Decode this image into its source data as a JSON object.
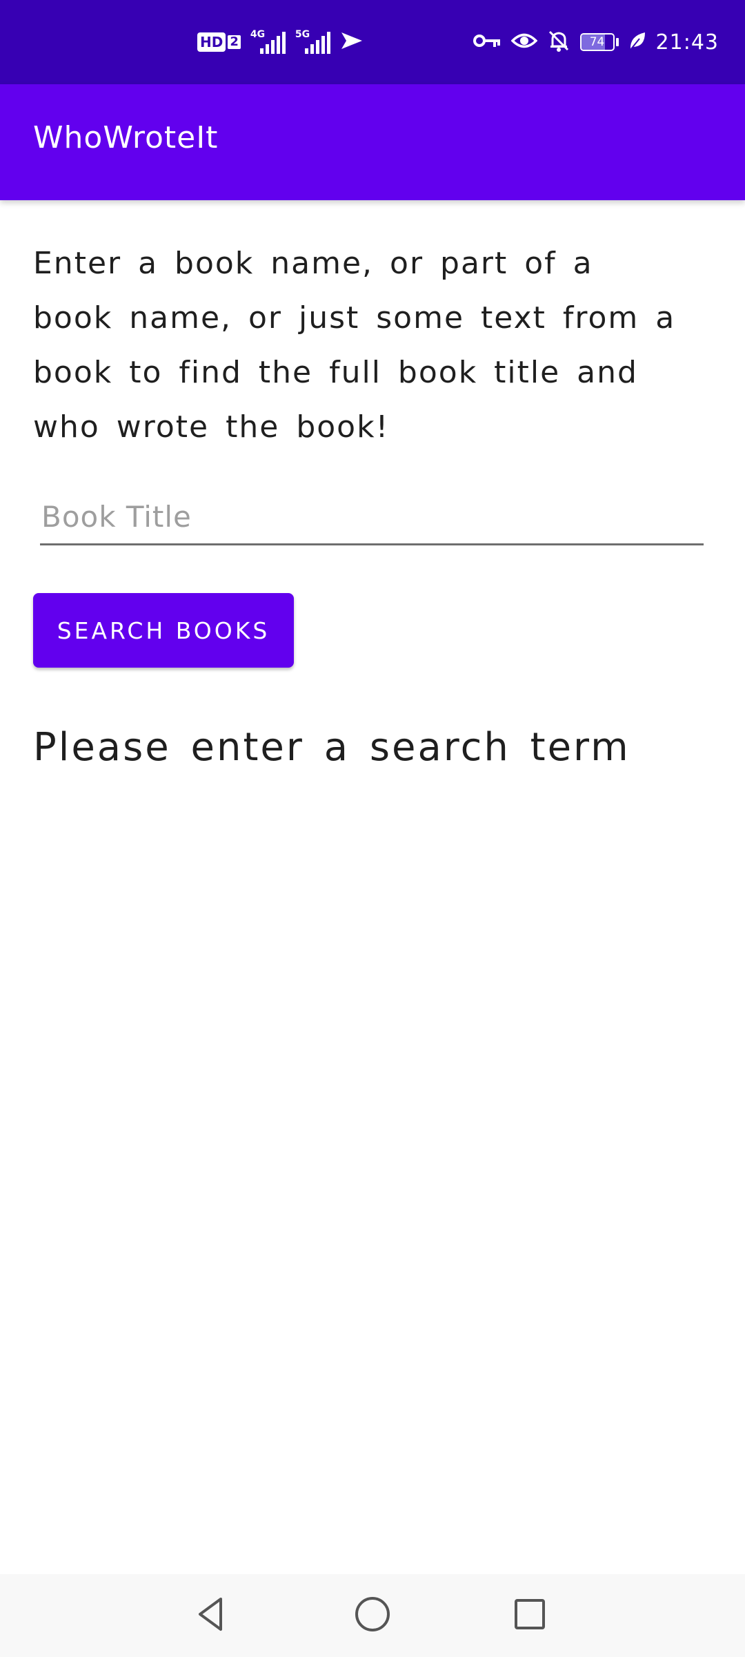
{
  "status_bar": {
    "hd_label": "HD",
    "sim_label": "2",
    "network_1": "4G",
    "network_2": "5G",
    "battery_level": 74,
    "battery_text": "74",
    "time": "21:43"
  },
  "app_bar": {
    "title": "WhoWroteIt"
  },
  "main": {
    "instructions": "Enter a book name, or part of a book name, or just some text from a book to find the full book title and who wrote the book!",
    "search_input": {
      "value": "",
      "placeholder": "Book Title"
    },
    "search_button_label": "SEARCH BOOKS",
    "result_text": "Please enter a search term"
  },
  "nav_bar": {
    "back_icon": "back-triangle-icon",
    "home_icon": "home-circle-icon",
    "recents_icon": "recents-square-icon"
  },
  "colors": {
    "status_bar": "#3700b3",
    "app_bar": "#6200ee",
    "button": "#6200ee",
    "nav_bar": "#f8f8f8"
  }
}
